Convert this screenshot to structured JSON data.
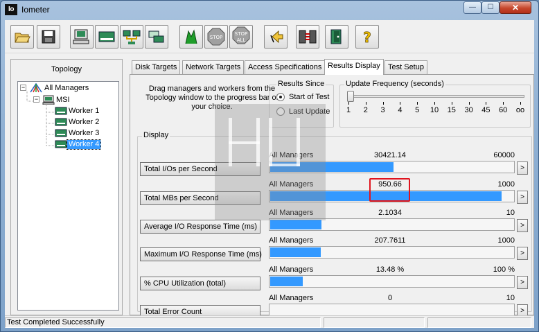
{
  "window": {
    "icon_text": "Io",
    "title": "Iometer",
    "minimize_glyph": "—",
    "maximize_glyph": "☐",
    "close_glyph": "✕"
  },
  "toolbar": {
    "buttons": [
      {
        "icon": "open-folder-icon",
        "color": "#e0b040"
      },
      {
        "icon": "save-disk-icon",
        "color": "#333333"
      },
      {
        "icon": "new-manager-icon",
        "color": "#2e8b57"
      },
      {
        "icon": "new-disk-worker-icon",
        "color": "#2e8b57"
      },
      {
        "icon": "new-network-worker-icon",
        "color": "#2e8b57"
      },
      {
        "icon": "duplicate-worker-icon",
        "color": "#2e8b57"
      },
      {
        "icon": "start-tests-icon",
        "color": "#1f9d2a"
      },
      {
        "icon": "stop-icon",
        "color": "#9a9a9a"
      },
      {
        "icon": "stop-all-icon",
        "color": "#9a9a9a"
      },
      {
        "icon": "reset-workers-icon",
        "color": "#d0a020"
      },
      {
        "icon": "disconnect-managers-icon",
        "color": "#444444"
      },
      {
        "icon": "exit-icon",
        "color": "#2e8b57"
      },
      {
        "icon": "about-help-icon",
        "color": "#f2c200"
      }
    ],
    "stop_label": "STOP",
    "all_label": "ALL",
    "help_label": "?"
  },
  "topology": {
    "title": "Topology",
    "root": "All Managers",
    "manager": "MSI",
    "workers": [
      "Worker 1",
      "Worker 2",
      "Worker 3",
      "Worker 4"
    ],
    "selected_worker": "Worker 4",
    "expander_glyph": "−"
  },
  "tabs": [
    "Disk Targets",
    "Network Targets",
    "Access Specifications",
    "Results Display",
    "Test Setup"
  ],
  "active_tab": "Results Display",
  "instructions": "Drag managers and workers from the Topology window to the progress bar of your choice.",
  "results_since": {
    "title": "Results Since",
    "options": [
      "Start of Test",
      "Last Update"
    ],
    "selected": "Start of Test"
  },
  "update_frequency": {
    "title": "Update Frequency (seconds)",
    "ticks": [
      "1",
      "2",
      "3",
      "4",
      "5",
      "10",
      "15",
      "30",
      "45",
      "60",
      "oo"
    ],
    "selected_index": 0
  },
  "display": {
    "title": "Display",
    "arrow_glyph": ">",
    "bar_color": "#3399ff",
    "highlight_color": "#e0141e",
    "metrics": [
      {
        "label": "Total I/Os per Second",
        "source": "All Managers",
        "value": "30421.14",
        "max": "60000",
        "fill": 0.507
      },
      {
        "label": "Total MBs per Second",
        "source": "All Managers",
        "value": "950.66",
        "max": "1000",
        "fill": 0.951,
        "highlighted": true
      },
      {
        "label": "Average I/O Response Time (ms)",
        "source": "All Managers",
        "value": "2.1034",
        "max": "10",
        "fill": 0.21
      },
      {
        "label": "Maximum I/O Response Time (ms)",
        "source": "All Managers",
        "value": "207.7611",
        "max": "1000",
        "fill": 0.208
      },
      {
        "label": "% CPU Utilization (total)",
        "source": "All Managers",
        "value": "13.48 %",
        "max": "100 %",
        "fill": 0.135
      },
      {
        "label": "Total Error Count",
        "source": "All Managers",
        "value": "0",
        "max": "10",
        "fill": 0.0
      }
    ]
  },
  "status_bar": {
    "message": "Test Completed Successfully"
  }
}
